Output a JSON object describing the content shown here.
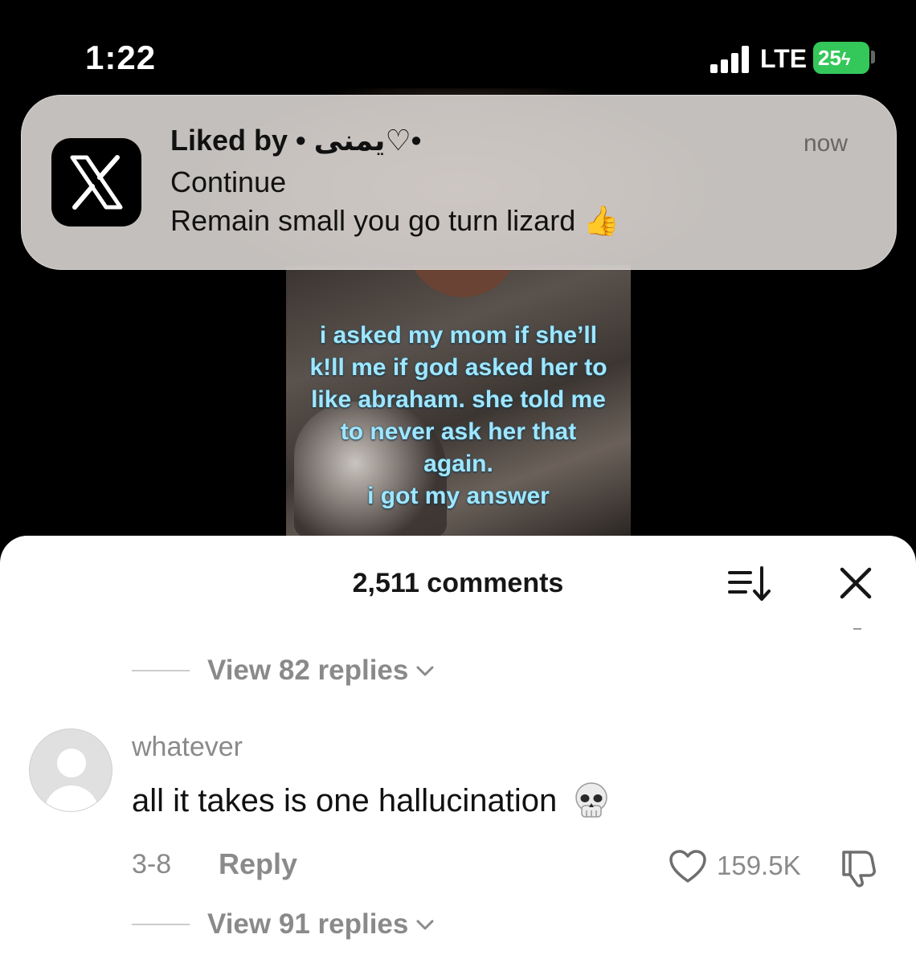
{
  "status_bar": {
    "time": "1:22",
    "network": "LTE",
    "battery": "25"
  },
  "notification": {
    "app_icon": "x-logo-icon",
    "title": "Liked by • يمنى♡•",
    "line1": "Continue",
    "line2": "Remain small you go turn lizard 👍",
    "time": "now"
  },
  "video": {
    "caption": "i asked my mom if she’ll\nk!ll me if god asked her to\nlike abraham. she told me\nto never ask her that\nagain.\ni got my answer",
    "caption_color": "#9fe6ff"
  },
  "comments_sheet": {
    "title": "2,511 comments",
    "sort_icon": "sort-icon",
    "close_icon": "close-icon",
    "view_replies_top": "View 82 replies",
    "comment": {
      "username": "whatever",
      "text": "all it takes is one hallucination",
      "emoji": "skull-emoji",
      "date": "3-8",
      "reply_label": "Reply",
      "like_count": "159.5K"
    },
    "view_replies_bottom": "View 91 replies"
  }
}
